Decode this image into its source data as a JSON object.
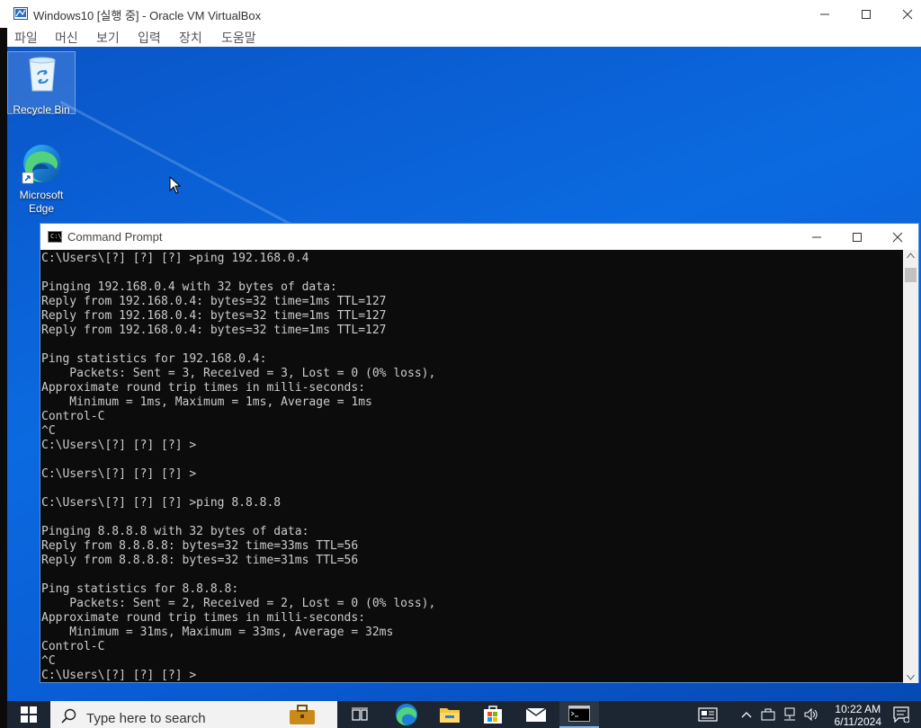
{
  "host_window": {
    "title": "Windows10 [실행 중] - Oracle VM VirtualBox",
    "menu": [
      "파일",
      "머신",
      "보기",
      "입력",
      "장치",
      "도움말"
    ]
  },
  "desktop": {
    "icons": [
      {
        "label": "Recycle Bin",
        "icon": "recycle-bin-icon"
      },
      {
        "label": "Microsoft Edge",
        "icon": "edge-icon"
      }
    ]
  },
  "cmd": {
    "title": "Command Prompt",
    "icon_text": "C:\\",
    "lines": [
      "C:\\Users\\[?] [?] [?] >ping 192.168.0.4",
      "",
      "Pinging 192.168.0.4 with 32 bytes of data:",
      "Reply from 192.168.0.4: bytes=32 time=1ms TTL=127",
      "Reply from 192.168.0.4: bytes=32 time=1ms TTL=127",
      "Reply from 192.168.0.4: bytes=32 time=1ms TTL=127",
      "",
      "Ping statistics for 192.168.0.4:",
      "    Packets: Sent = 3, Received = 3, Lost = 0 (0% loss),",
      "Approximate round trip times in milli-seconds:",
      "    Minimum = 1ms, Maximum = 1ms, Average = 1ms",
      "Control-C",
      "^C",
      "C:\\Users\\[?] [?] [?] >",
      "",
      "C:\\Users\\[?] [?] [?] >",
      "",
      "C:\\Users\\[?] [?] [?] >ping 8.8.8.8",
      "",
      "Pinging 8.8.8.8 with 32 bytes of data:",
      "Reply from 8.8.8.8: bytes=32 time=33ms TTL=56",
      "Reply from 8.8.8.8: bytes=32 time=31ms TTL=56",
      "",
      "Ping statistics for 8.8.8.8:",
      "    Packets: Sent = 2, Received = 2, Lost = 0 (0% loss),",
      "Approximate round trip times in milli-seconds:",
      "    Minimum = 31ms, Maximum = 33ms, Average = 32ms",
      "Control-C",
      "^C",
      "C:\\Users\\[?] [?] [?] >"
    ]
  },
  "taskbar": {
    "search_placeholder": "Type here to search",
    "time": "10:22 AM",
    "date": "6/11/2024",
    "pinned": [
      "briefcase-icon",
      "task-view-icon",
      "edge-icon",
      "file-explorer-icon",
      "store-icon",
      "mail-icon",
      "cmd-icon"
    ],
    "tray": [
      "news-icon",
      "chevron-up-icon",
      "tray-app-icon",
      "network-icon",
      "volume-icon",
      "notification-icon"
    ]
  },
  "colors": {
    "desktop_blue": "#0a5bd3",
    "console_bg": "#0c0c0c",
    "console_text": "#cccccc",
    "taskbar_bg": "#1c2633"
  }
}
